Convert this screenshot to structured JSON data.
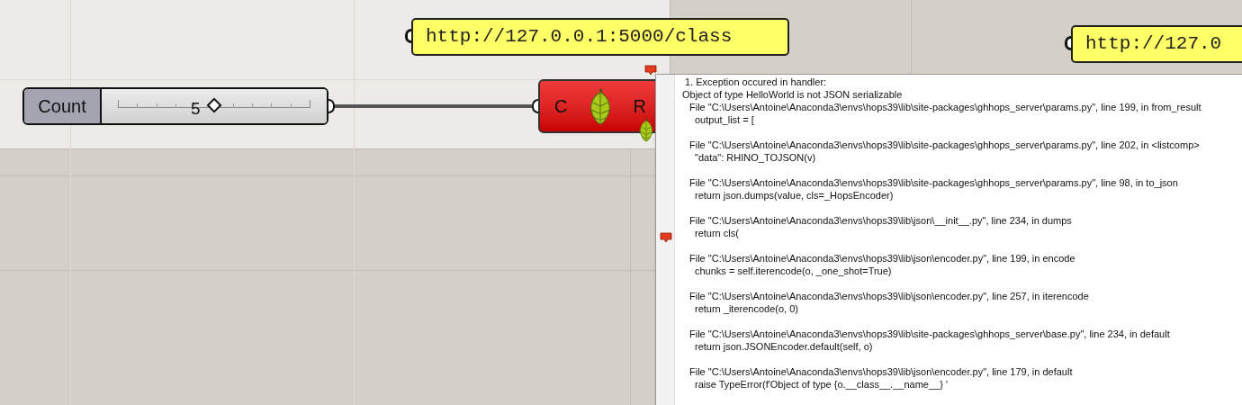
{
  "slider": {
    "label": "Count",
    "value": "5",
    "level": 0.5
  },
  "panels": [
    {
      "text": "http://127.0.0.1:5000/class"
    },
    {
      "text": "http://127.0"
    }
  ],
  "component": {
    "input": "C",
    "output": "R",
    "error": true
  },
  "tooltip": {
    "title": "1. Exception occured in handler:",
    "message": "Object of type HelloWorld is not JSON serializable",
    "frames": [
      {
        "file": "File \"C:\\Users\\Antoine\\Anaconda3\\envs\\hops39\\lib\\site-packages\\ghhops_server\\params.py\", line 199, in from_result",
        "code": "output_list = ["
      },
      {
        "file": "File \"C:\\Users\\Antoine\\Anaconda3\\envs\\hops39\\lib\\site-packages\\ghhops_server\\params.py\", line 202, in <listcomp>",
        "code": "\"data\": RHINO_TOJSON(v)"
      },
      {
        "file": "File \"C:\\Users\\Antoine\\Anaconda3\\envs\\hops39\\lib\\site-packages\\ghhops_server\\params.py\", line 98, in to_json",
        "code": "return json.dumps(value, cls=_HopsEncoder)"
      },
      {
        "file": "File \"C:\\Users\\Antoine\\Anaconda3\\envs\\hops39\\lib\\json\\__init__.py\", line 234, in dumps",
        "code": "return cls("
      },
      {
        "file": "File \"C:\\Users\\Antoine\\Anaconda3\\envs\\hops39\\lib\\json\\encoder.py\", line 199, in encode",
        "code": "chunks = self.iterencode(o, _one_shot=True)"
      },
      {
        "file": "File \"C:\\Users\\Antoine\\Anaconda3\\envs\\hops39\\lib\\json\\encoder.py\", line 257, in iterencode",
        "code": "return _iterencode(o, 0)"
      },
      {
        "file": "File \"C:\\Users\\Antoine\\Anaconda3\\envs\\hops39\\lib\\site-packages\\ghhops_server\\base.py\", line 234, in default",
        "code": "return json.JSONEncoder.default(self, o)"
      },
      {
        "file": "File \"C:\\Users\\Antoine\\Anaconda3\\envs\\hops39\\lib\\json\\encoder.py\", line 179, in default",
        "code": "raise TypeError(f'Object of type {o.__class__.__name__} '"
      }
    ]
  }
}
